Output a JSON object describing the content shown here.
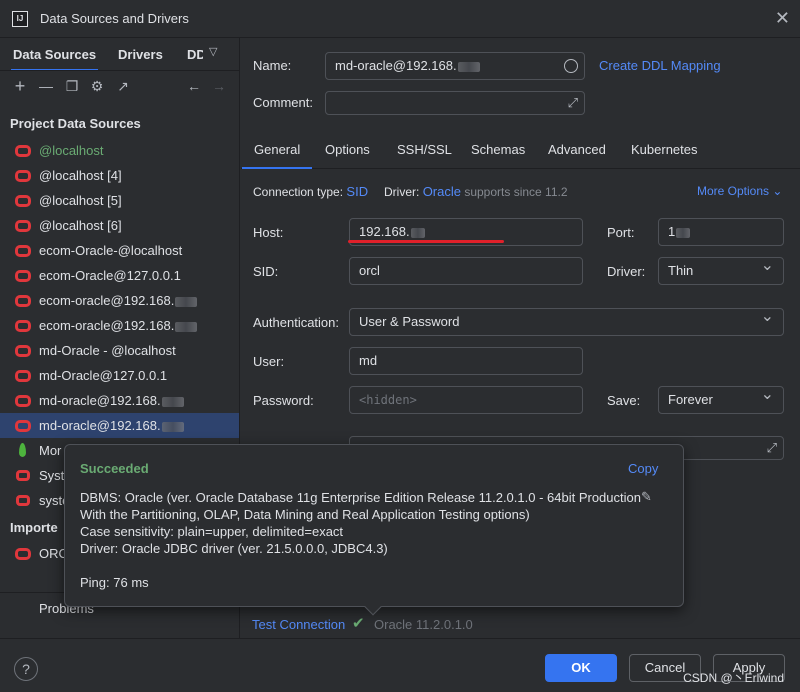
{
  "window": {
    "title": "Data Sources and Drivers",
    "app_icon_text": "IJ"
  },
  "left": {
    "tabs": [
      "Data Sources",
      "Drivers",
      "DD"
    ],
    "tab_overflow_icon": "chevron-down-icon",
    "toolbar_icons": [
      "add-icon",
      "remove-icon",
      "copy-icon",
      "settings-icon",
      "export-icon",
      "back-arrow-icon",
      "forward-arrow-icon"
    ],
    "project_header": "Project Data Sources",
    "items": [
      {
        "label": "@localhost",
        "icon": "oracle-icon",
        "green": true
      },
      {
        "label": "@localhost [4]",
        "icon": "oracle-icon"
      },
      {
        "label": "@localhost [5]",
        "icon": "oracle-icon"
      },
      {
        "label": "@localhost [6]",
        "icon": "oracle-icon"
      },
      {
        "label": "ecom-Oracle-@localhost",
        "icon": "oracle-icon"
      },
      {
        "label": "ecom-Oracle@127.0.0.1",
        "icon": "oracle-icon"
      },
      {
        "label": "ecom-oracle@192.168.",
        "icon": "oracle-icon",
        "blurred": true
      },
      {
        "label": "ecom-oracle@192.168.",
        "icon": "oracle-icon",
        "blurred": true
      },
      {
        "label": "md-Oracle - @localhost",
        "icon": "oracle-icon"
      },
      {
        "label": "md-Oracle@127.0.0.1",
        "icon": "oracle-icon"
      },
      {
        "label": "md-oracle@192.168.",
        "icon": "oracle-icon",
        "blurred": true
      },
      {
        "label": "md-oracle@192.168.",
        "icon": "oracle-icon",
        "blurred": true,
        "selected": true
      },
      {
        "label": "Mor",
        "icon": "mongodb-icon"
      },
      {
        "label": "Syste",
        "icon": "system-icon"
      },
      {
        "label": "syste",
        "icon": "system-icon"
      }
    ],
    "imported_header": "Importe",
    "imported_items": [
      {
        "label": "ORC",
        "icon": "oracle-icon"
      }
    ],
    "problems_label": "Problems"
  },
  "form": {
    "name_label": "Name:",
    "name_value": "md-oracle@192.168.",
    "create_ddl_link": "Create DDL Mapping",
    "comment_label": "Comment:",
    "comment_value": "",
    "tabs": [
      "General",
      "Options",
      "SSH/SSL",
      "Schemas",
      "Advanced",
      "Kubernetes"
    ],
    "active_tab": "General",
    "connection_type_label": "Connection type:",
    "connection_type_value": "SID",
    "driver_info_label": "Driver:",
    "driver_info_value": "Oracle",
    "driver_info_suffix": "supports since 11.2",
    "more_options": "More Options",
    "host_label": "Host:",
    "host_value": "192.168.",
    "port_label": "Port:",
    "port_value": "1",
    "sid_label": "SID:",
    "sid_value": "orcl",
    "driver_label": "Driver:",
    "driver_value": "Thin",
    "auth_label": "Authentication:",
    "auth_value": "User & Password",
    "user_label": "User:",
    "user_value": "md",
    "password_label": "Password:",
    "password_placeholder": "<hidden>",
    "save_label": "Save:",
    "save_value": "Forever"
  },
  "popup": {
    "status": "Succeeded",
    "copy_label": "Copy",
    "lines": [
      "DBMS: Oracle (ver. Oracle Database 11g Enterprise Edition Release 11.2.0.1.0 - 64bit Production",
      "With the Partitioning, OLAP, Data Mining and Real Application Testing options)",
      "Case sensitivity: plain=upper, delimited=exact",
      "Driver: Oracle JDBC driver (ver. 21.5.0.0.0, JDBC4.3)"
    ],
    "ping": "Ping: 76 ms"
  },
  "test_connection": {
    "label": "Test Connection",
    "result": "Oracle 11.2.0.1.0"
  },
  "footer": {
    "help": "?",
    "ok": "OK",
    "cancel": "Cancel",
    "apply": "Apply",
    "watermark": "CSDN @丶Erlwind"
  },
  "colors": {
    "accent": "#3574f0",
    "link": "#548af7",
    "success": "#6aab73",
    "oracle_red": "#e0373c",
    "underline_red": "#e0202a",
    "background": "#2b2d30"
  }
}
